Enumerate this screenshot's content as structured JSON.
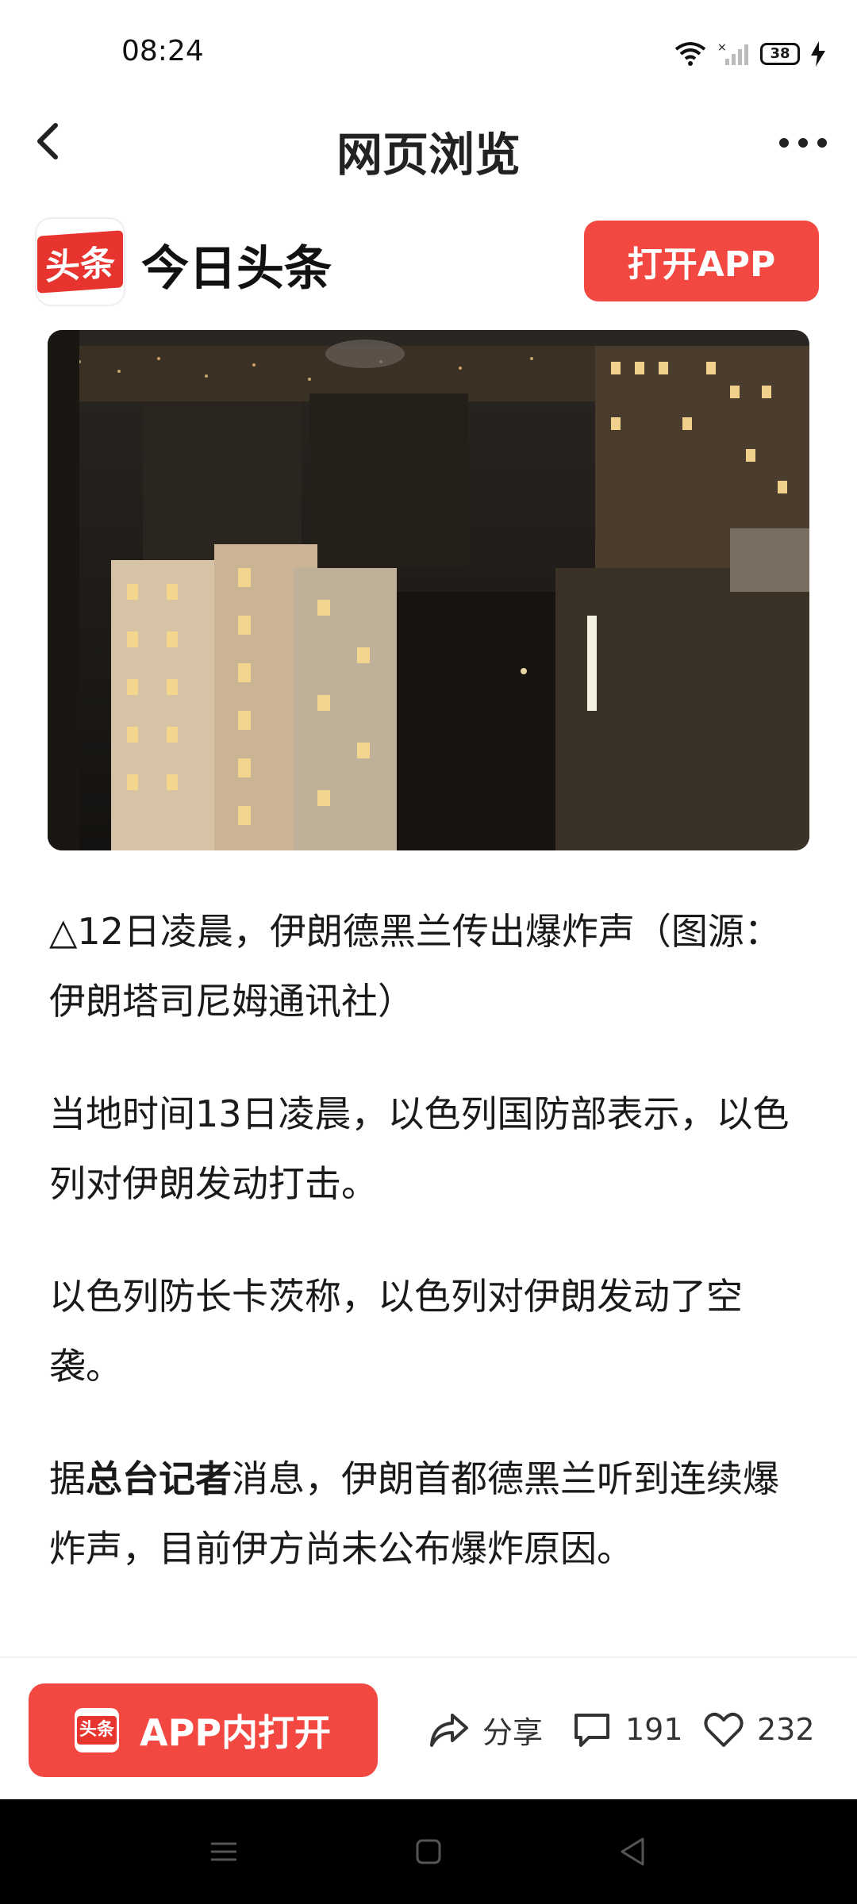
{
  "status_bar": {
    "time": "08:24",
    "battery": "38"
  },
  "nav": {
    "title": "网页浏览"
  },
  "brand": {
    "logo_text": "头条",
    "name": "今日头条",
    "open_app_label": "打开APP"
  },
  "article": {
    "caption": "△12日凌晨，伊朗德黑兰传出爆炸声（图源：伊朗塔司尼姆通讯社）",
    "p1": "当地时间13日凌晨，以色列国防部表示，以色列对伊朗发动打击。",
    "p2": "以色列防长卡茨称，以色列对伊朗发动了空袭。",
    "p3_prefix": "据",
    "p3_bold": "总台记者",
    "p3_suffix": "消息，伊朗首都德黑兰听到连续爆炸声，目前伊方尚未公布爆炸原因。"
  },
  "action_bar": {
    "app_open_label": "APP内打开",
    "app_logo_text": "头条",
    "share_label": "分享",
    "comment_count": "191",
    "like_count": "232"
  },
  "colors": {
    "brand_red": "#f24841",
    "logo_red": "#e8342f"
  }
}
